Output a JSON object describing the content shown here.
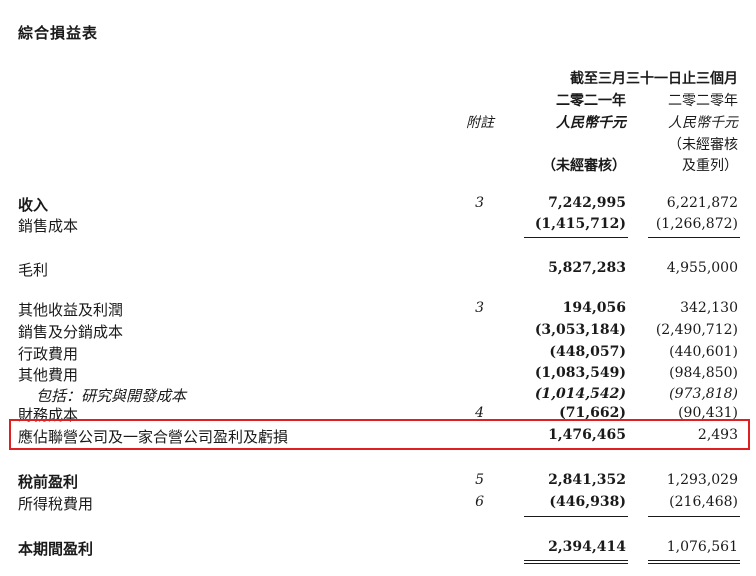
{
  "title": "綜合損益表",
  "header": {
    "period": "截至三月三十一日止三個月",
    "note_col": "附註",
    "col1": {
      "year": "二零二一年",
      "unit": "人民幣千元",
      "audit": "（未經審核）"
    },
    "col2": {
      "year": "二零二零年",
      "unit": "人民幣千元",
      "audit1": "（未經審核",
      "audit2": "及重列）"
    }
  },
  "rows": [
    {
      "label": "收入",
      "note": "3",
      "v2021": "7,242,995",
      "v2020": "6,221,872"
    },
    {
      "label": "銷售成本",
      "note": "",
      "v2021": "(1,415,712)",
      "v2020": "(1,266,872)"
    },
    {
      "label": "毛利",
      "note": "",
      "v2021": "5,827,283",
      "v2020": "4,955,000"
    },
    {
      "label": "其他收益及利潤",
      "note": "3",
      "v2021": "194,056",
      "v2020": "342,130"
    },
    {
      "label": "銷售及分銷成本",
      "note": "",
      "v2021": "(3,053,184)",
      "v2020": "(2,490,712)"
    },
    {
      "label": "行政費用",
      "note": "",
      "v2021": "(448,057)",
      "v2020": "(440,601)"
    },
    {
      "label": "其他費用",
      "note": "",
      "v2021": "(1,083,549)",
      "v2020": "(984,850)"
    },
    {
      "label": "包括：研究與開發成本",
      "note": "",
      "v2021": "(1,014,542)",
      "v2020": "(973,818)"
    },
    {
      "label": "財務成本",
      "note": "4",
      "v2021": "(71,662)",
      "v2020": "(90,431)"
    },
    {
      "label": "應佔聯營公司及一家合營公司盈利及虧損",
      "note": "",
      "v2021": "1,476,465",
      "v2020": "2,493"
    },
    {
      "label": "稅前盈利",
      "note": "5",
      "v2021": "2,841,352",
      "v2020": "1,293,029"
    },
    {
      "label": "所得稅費用",
      "note": "6",
      "v2021": "(446,938)",
      "v2020": "(216,468)"
    },
    {
      "label": "本期間盈利",
      "note": "",
      "v2021": "2,394,414",
      "v2020": "1,076,561"
    }
  ]
}
